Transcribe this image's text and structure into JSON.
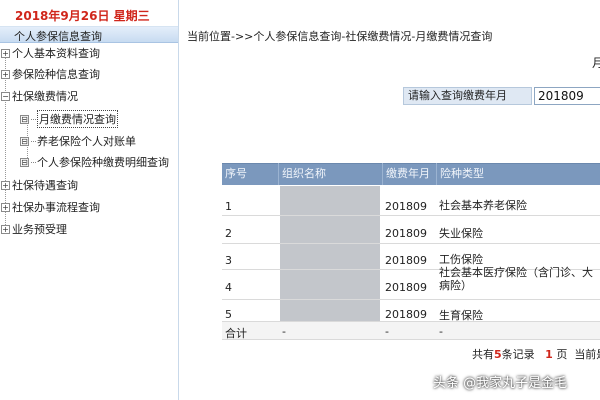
{
  "date_bar": "2018年9月26日  星期三",
  "nav_header": "个人参保信息查询",
  "nav_items": [
    {
      "label": "个人基本资料查询",
      "expander": "+"
    },
    {
      "label": "参保险种信息查询",
      "expander": "+"
    },
    {
      "label": "社保缴费情况",
      "expander": "−"
    },
    {
      "label": "月缴费情况查询",
      "expander": "⊟"
    },
    {
      "label": "养老保险个人对账单",
      "expander": "⊟"
    },
    {
      "label": "个人参保险种缴费明细查询",
      "expander": "⊟"
    },
    {
      "label": "社保待遇查询",
      "expander": "+"
    },
    {
      "label": "社保办事流程查询",
      "expander": "+"
    },
    {
      "label": "业务预受理",
      "expander": "+"
    }
  ],
  "breadcrumb": "当前位置->>个人参保信息查询-社保缴费情况-月缴费情况查询",
  "right_title_char": "月",
  "query": {
    "label": "请输入查询缴费年月",
    "value": "201809"
  },
  "table": {
    "headers": [
      "序号",
      "组织名称",
      "缴费年月",
      "险种类型"
    ],
    "rows": [
      {
        "no": "1",
        "month": "201809",
        "type": "社会基本养老保险"
      },
      {
        "no": "2",
        "month": "201809",
        "type": "失业保险"
      },
      {
        "no": "3",
        "month": "201809",
        "type": "工伤保险"
      },
      {
        "no": "4",
        "month": "201809",
        "type": "社会基本医疗保险（含门诊、大病险）"
      },
      {
        "no": "5",
        "month": "201809",
        "type": "生育保险"
      }
    ],
    "total_row": {
      "no": "合计",
      "org": "-",
      "month": "-",
      "type": "-"
    }
  },
  "pager": {
    "prefix": "共有",
    "count": "5",
    "suffix": "条记录",
    "page": "1",
    "page_suffix": "页",
    "current": "当前是"
  },
  "watermark": "头条 @我家丸子是金毛"
}
